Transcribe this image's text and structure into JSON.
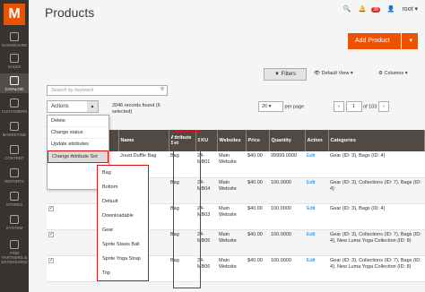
{
  "sidebar": {
    "logo": "M",
    "items": [
      {
        "label": "DASHBOARD"
      },
      {
        "label": "SALES"
      },
      {
        "label": "CATALOG"
      },
      {
        "label": "CUSTOMERS"
      },
      {
        "label": "MARKETING"
      },
      {
        "label": "CONTENT"
      },
      {
        "label": "REPORTS"
      },
      {
        "label": "STORES"
      },
      {
        "label": "SYSTEM"
      },
      {
        "label": "FIND PARTNERS & EXTENSIONS"
      }
    ]
  },
  "header": {
    "title": "Products",
    "notif_count": "38",
    "user": "root"
  },
  "toolbar": {
    "add_label": "Add Product",
    "filters_label": "Filters",
    "default_view_label": "Default View",
    "columns_label": "Columns",
    "search_placeholder": "Search by keyword",
    "actions_label": "Actions",
    "records_line1": "2046 records found (6",
    "records_line2": "selected)",
    "per_page_value": "20",
    "per_page_label": "per page",
    "page_value": "1",
    "page_total": "of 103"
  },
  "columns": [
    "",
    "ID",
    "Thumbnail",
    "Name",
    "Attribute Set",
    "SKU",
    "Websites",
    "Price",
    "Quantity",
    "Action",
    "Categories"
  ],
  "rows": [
    {
      "check": "✓",
      "name": "Joust Duffle Bag",
      "attr": "Bag",
      "sku": "24-MB01",
      "web": "Main Website",
      "price": "$40.00",
      "qty": "99999.0000",
      "action": "Edit",
      "cat": "Gear (ID: 3), Bags (ID: 4)"
    },
    {
      "check": "✓",
      "name": "...der",
      "attr": "Bag",
      "sku": "24-MB04",
      "web": "Main Website",
      "price": "$40.00",
      "qty": "100.0000",
      "action": "Edit",
      "cat": "Gear (ID: 3), Collections (ID: 7), Bags (ID: 4)"
    },
    {
      "check": "✓",
      "name": "...mit",
      "attr": "Bag",
      "sku": "24-MB03",
      "web": "Main Website",
      "price": "$40.00",
      "qty": "100.0000",
      "action": "Edit",
      "cat": "Gear (ID: 3), Bags (ID: 4)"
    },
    {
      "check": "✓",
      "name": "",
      "attr": "Bag",
      "sku": "24-MB05",
      "web": "Main Website",
      "price": "$40.00",
      "qty": "100.0000",
      "action": "Edit",
      "cat": "Gear (ID: 3), Collections (ID: 7), Bags (ID: 4), New Luma Yoga Collection (ID: 8)"
    },
    {
      "check": "✓",
      "name": "",
      "attr": "Bag",
      "sku": "24-MB06",
      "web": "Main Website",
      "price": "$40.00",
      "qty": "100.0000",
      "action": "Edit",
      "cat": "Gear (ID: 3), Collections (ID: 7), Bags (ID: 4), New Luma Yoga Collection (ID: 8)"
    }
  ],
  "actions_menu": [
    "Delete",
    "Change status",
    "Update attributes",
    "Change Attribute Set"
  ],
  "attr_submenu": [
    "Bag",
    "Bottom",
    "Default",
    "Downloadable",
    "Gear",
    "Sprite Stasis Ball",
    "Sprite Yoga Strap",
    "Top"
  ],
  "colors": {
    "accent": "#eb5202",
    "sidebar": "#373330",
    "header": "#514943",
    "highlight": "#d11111"
  }
}
